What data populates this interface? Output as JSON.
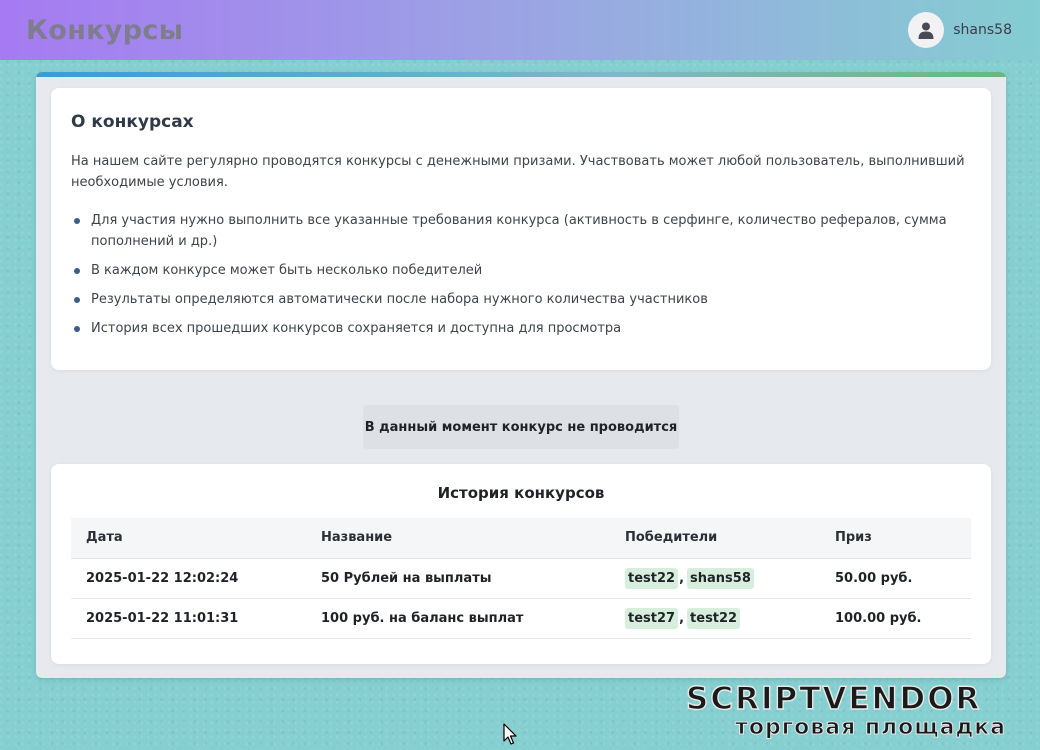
{
  "header": {
    "title": "Конкурсы",
    "user_name": "shans58"
  },
  "about": {
    "heading": "О конкурсах",
    "intro": "На нашем сайте регулярно проводятся конкурсы с денежными призами. Участвовать может любой пользователь, выполнивший необходимые условия.",
    "items": [
      "Для участия нужно выполнить все указанные требования конкурса (активность в серфинге, количество рефералов, сумма пополнений и др.)",
      "В каждом конкурсе может быть несколько победителей",
      "Результаты определяются автоматически после набора нужного количества участников",
      "История всех прошедших конкурсов сохраняется и доступна для просмотра"
    ]
  },
  "status_message": "В данный момент конкурс не проводится",
  "history": {
    "heading": "История конкурсов",
    "columns": [
      "Дата",
      "Название",
      "Победители",
      "Приз"
    ],
    "rows": [
      {
        "date": "2025-01-22 12:02:24",
        "name": "50 Рублей на выплаты",
        "winners": [
          "test22",
          "shans58"
        ],
        "prize": "50.00 руб."
      },
      {
        "date": "2025-01-22 11:01:31",
        "name": "100 руб. на баланс выплат",
        "winners": [
          "test27",
          "test22"
        ],
        "prize": "100.00 руб."
      }
    ]
  },
  "watermark": {
    "line1": "SCRIPTVENDOR",
    "line2": "торговая площадка"
  },
  "colors": {
    "background": "#86cfd1",
    "header_gradient_start": "#a67af2",
    "winner_badge": "#d7eedd"
  },
  "icons": {
    "avatar": "user-icon",
    "cursor": "mouse-pointer-icon"
  }
}
